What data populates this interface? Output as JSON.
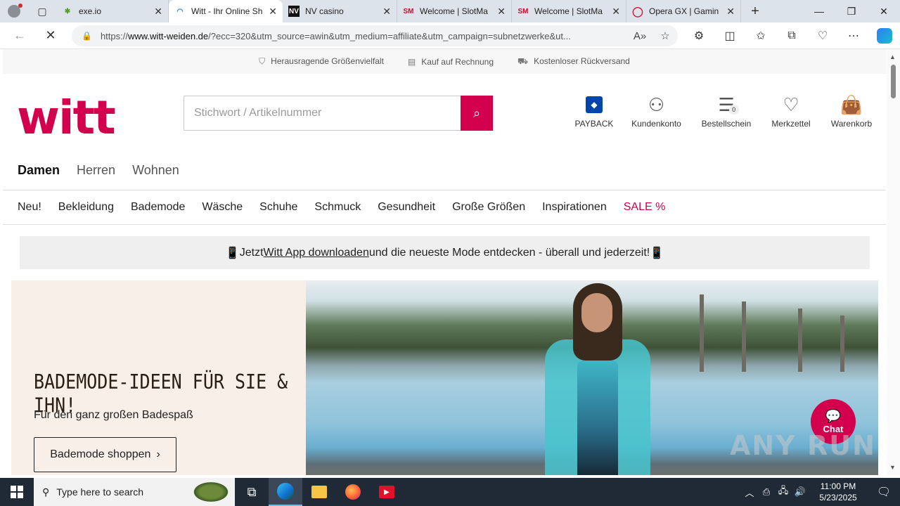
{
  "browser": {
    "tabs": [
      {
        "title": "exe.io",
        "favicon": "exe-io-icon",
        "active": false
      },
      {
        "title": "Witt - Ihr Online Sh",
        "favicon": "loading-spinner-icon",
        "active": true
      },
      {
        "title": "NV casino",
        "favicon": "NV",
        "active": false
      },
      {
        "title": "Welcome | SlotMa",
        "favicon": "SM",
        "active": false
      },
      {
        "title": "Welcome | SlotMa",
        "favicon": "SM",
        "active": false
      },
      {
        "title": "Opera GX | Gamin",
        "favicon": "opera-icon",
        "active": false
      }
    ],
    "url_prefix": "https://",
    "url_domain": "www.witt-weiden.de",
    "url_rest": "/?ecc=320&utm_source=awin&utm_medium=affiliate&utm_campaign=subnetzwerke&ut..."
  },
  "site": {
    "usp": [
      "Herausragende Größenvielfalt",
      "Kauf auf Rechnung",
      "Kostenloser Rückversand"
    ],
    "logo": "witt",
    "search_placeholder": "Stichwort / Artikelnummer",
    "header_icons": [
      {
        "label": "PAYBACK",
        "icon": "payback-icon"
      },
      {
        "label": "Kundenkonto",
        "icon": "user-icon"
      },
      {
        "label": "Bestellschein",
        "icon": "order-list-icon",
        "badge": "0"
      },
      {
        "label": "Merkzettel",
        "icon": "heart-icon"
      },
      {
        "label": "Warenkorb",
        "icon": "shopping-bag-icon"
      }
    ],
    "gender_tabs": [
      "Damen",
      "Herren",
      "Wohnen"
    ],
    "categories": [
      "Neu!",
      "Bekleidung",
      "Bademode",
      "Wäsche",
      "Schuhe",
      "Schmuck",
      "Gesundheit",
      "Große Größen",
      "Inspirationen",
      "SALE %"
    ],
    "app_banner": {
      "pre": "Jetzt ",
      "link": "Witt App downloaden",
      "post": " und die neueste Mode entdecken - überall und jederzeit!"
    },
    "hero": {
      "title": "BADEMODE-IDEEN FÜR SIE & IHN!",
      "subtitle": "Für den ganz großen Badespaß",
      "button": "Bademode shoppen"
    },
    "chat_label": "Chat",
    "watermark": "ANY RUN"
  },
  "taskbar": {
    "search_placeholder": "Type here to search",
    "time": "11:00 PM",
    "date": "5/23/2025"
  },
  "colors": {
    "brand": "#d2004d"
  }
}
